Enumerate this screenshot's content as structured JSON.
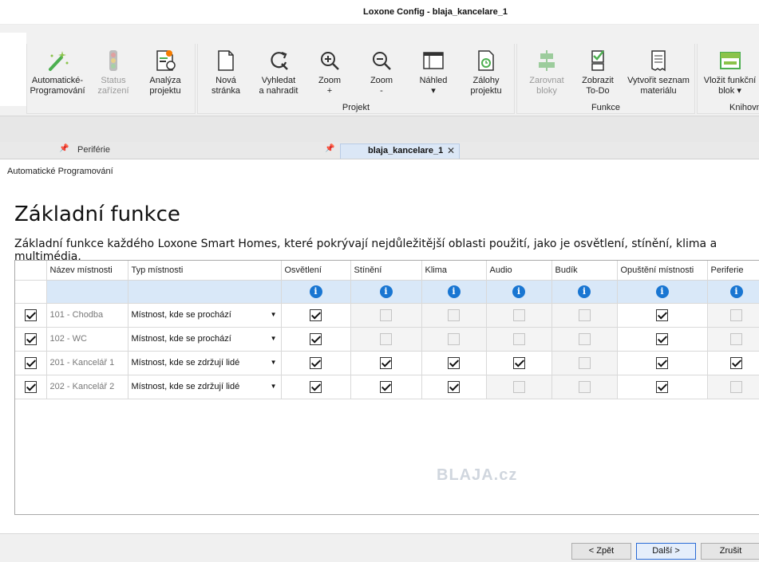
{
  "window": {
    "title": "Loxone Config - blaja_kancelare_1"
  },
  "ribbon": {
    "buttons": {
      "auto_prog": "Automatické-\nProgramování",
      "status": "Status\nzařízení",
      "analysis": "Analýza\nprojektu",
      "new_page": "Nová\nstránka",
      "search_replace": "Vyhledat\na nahradit",
      "zoom_in": "Zoom\n+",
      "zoom_out": "Zoom\n-",
      "preview": "Náhled\n▾",
      "backups": "Zálohy\nprojektu",
      "align": "Zarovnat\nbloky",
      "todo": "Zobrazit\nTo-Do",
      "materials": "Vytvořit seznam\nmateriálu",
      "insert_block": "Vložit funkční\nblok ▾"
    },
    "groups": {
      "projekt": "Projekt",
      "funkce": "Funkce",
      "knihovna": "Knihovn"
    }
  },
  "panels": {
    "periphery": "Periférie"
  },
  "tab": {
    "label": "blaja_kancelare_1",
    "close": "✕"
  },
  "dialog": {
    "title": "Automatické Programování",
    "heading": "Základní funkce",
    "description": "Základní funkce každého Loxone Smart Homes, které pokrývají nejdůležitější oblasti použití, jako je osvětlení, stínění, klima a multimédia.",
    "columns": {
      "name": "Název místnosti",
      "type": "Typ místnosti",
      "lighting": "Osvětlení",
      "shading": "Stínění",
      "climate": "Klima",
      "audio": "Audio",
      "alarm": "Budík",
      "leaving": "Opuštění místnosti",
      "periphery": "Periferie"
    },
    "info_icon": "i",
    "rows": [
      {
        "name": "101 - Chodba",
        "type": "Místnost, kde se prochází"
      },
      {
        "name": "102 - WC",
        "type": "Místnost, kde se prochází"
      },
      {
        "name": "201 - Kancelář 1",
        "type": "Místnost, kde se zdržují lidé"
      },
      {
        "name": "202 - Kancelář 2",
        "type": "Místnost, kde se zdržují lidé"
      }
    ],
    "watermark": "BLAJA.cz",
    "buttons": {
      "back": "< Zpět",
      "next": "Další >",
      "cancel": "Zrušit"
    }
  }
}
